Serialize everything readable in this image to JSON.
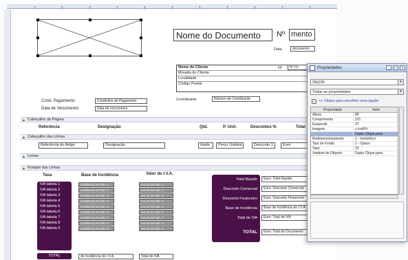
{
  "header": {
    "doc_title": "Nome do Documento",
    "no_label": "Nº",
    "doc_num": "mento",
    "date_label": "Data",
    "date_value": "documento"
  },
  "client": {
    "rows": [
      "Nome do Cliente",
      "Morada do Cliente",
      "Localidade",
      "Código Postal"
    ],
    "no_label": "Nº",
    "no_value": "Nº Cli",
    "contrib_label": "Contribuinte",
    "contrib_value": "Número de Contribuinte"
  },
  "payment": {
    "cond_label": "Cond. Pagamento:",
    "cond_value": "Condições de Pagamento",
    "due_label": "Data de Vencimento:",
    "due_value": "Data de vencimento"
  },
  "sections": {
    "page_header": "Cabeçalho da Página",
    "lines_header": "Cabeçalho das Linhas",
    "lines": "Linhas",
    "lines_footer": "Rodapé das Linhas"
  },
  "columns": {
    "ref": "Referência",
    "desig": "Designação",
    "qty": "Qtd.",
    "price": "P. Unit.",
    "disc": "Descontos %",
    "total": "Total"
  },
  "line_fields": {
    "ref": "Referência do Artigo",
    "desig": "Designação",
    "qty": "Idade",
    "price": "Preço Unitário",
    "disc": "Desconto 1",
    "total": "Euro"
  },
  "footer_cols": {
    "tax": "Taxa",
    "base": "Base de Incidência",
    "iva": "Valor do I.V.A."
  },
  "tax_rows": [
    "IVA tabela 1",
    "IVA tabela 2",
    "IVA tabela 3",
    "IVA tabela 4",
    "IVA tabela 5",
    "IVA tabela 6",
    "IVA tabela 7",
    "IVA tabela 8",
    "IVA tabela 9"
  ],
  "base_rows": [
    "Incidência IVA tab. 1",
    "Incidência IVA tab. 2",
    "Incidência IVA tab. 3",
    "Incidência IVA tab. 4",
    "Incidência IVA tab. 5",
    "Incidência IVA tab. 6",
    "Incidência IVA tab. 7",
    "Incidência IVA tab. 8",
    "Incidência IVA tab. 9"
  ],
  "iva_rows": [
    "Iva do IVA tab. 1",
    "Iva do IVA tab. 2",
    "Iva do IVA tab. 3",
    "Iva do IVA tab. 4",
    "Iva do IVA tab. 5",
    "Iva do IVA tab. 6",
    "Iva do IVA tab. 7",
    "Iva do IVA tab. 8",
    "Iva do IVA tab. 9"
  ],
  "totals_bottom": {
    "label": "TOTAL",
    "base": "de Incidência do I.V.A.",
    "iva": "Total do IVA"
  },
  "totals": {
    "labels": [
      "Total Ilíquido",
      "Desconto Comercial",
      "Desconto Financeiro",
      "Base de Incidência",
      "Total de IVA",
      "TOTAL"
    ],
    "values": [
      "Euro: Total Ilíquido",
      "Euro: Desconto Comercial",
      "Euro: Desconto Financeiro",
      "Base de Incidência do I.V.A.",
      "Euro: Total de IVA",
      "Euro: Total do Documento"
    ]
  },
  "props": {
    "title": "Propriedades",
    "object_select": "Obj106",
    "filter_select": "Todas as propriedades",
    "link": "<< Clique para escolher uma opção",
    "col_prop": "Propriedade",
    "col_val": "Valor",
    "rows": [
      {
        "k": "Altura",
        "v": "80"
      },
      {
        "k": "Comprimento",
        "v": "221"
      },
      {
        "k": "Esquerda",
        "v": "37"
      },
      {
        "k": "Imagem",
        "v": "c:\\caf\\Pr"
      },
      {
        "k": "",
        "v": "Duplo Clique para"
      },
      {
        "k": "Redimensionamento",
        "v": "1 - Isométrico"
      },
      {
        "k": "Tipo de Fundo",
        "v": "1 - Opaco"
      },
      {
        "k": "Topo",
        "v": "23"
      },
      {
        "k": "Variável do Objecto",
        "v": "Duplo Clique para"
      }
    ]
  },
  "colors": {
    "purple": "#4a1048",
    "grey_field": "#9a9a9a",
    "props_selection": "#9fb4d8"
  }
}
